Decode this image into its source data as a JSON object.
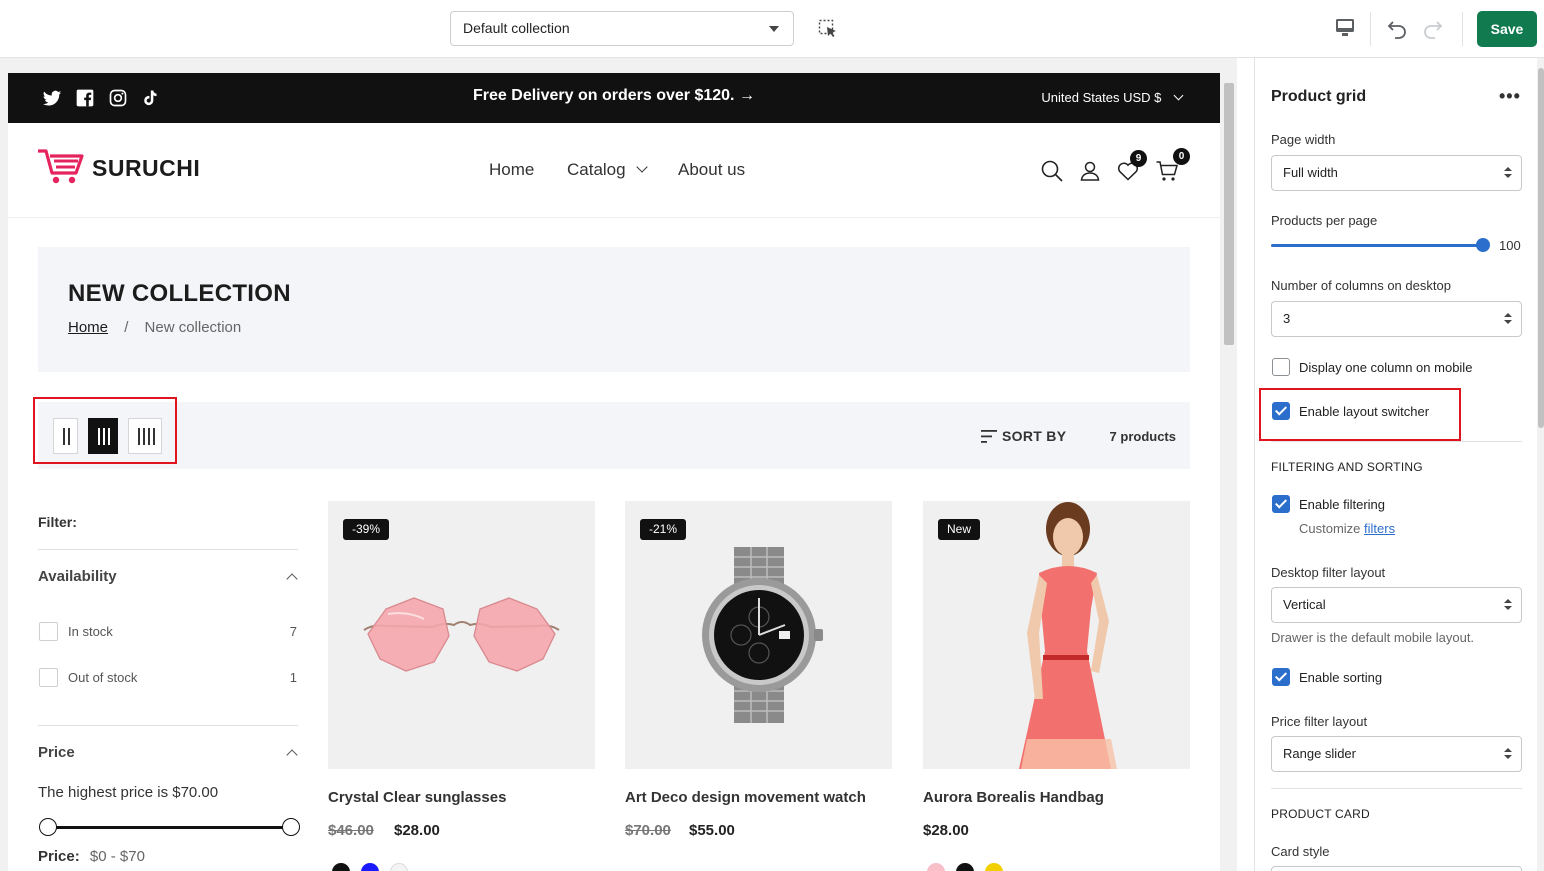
{
  "topbar": {
    "collection_select": "Default collection",
    "save_label": "Save"
  },
  "announcement": {
    "text": "Free Delivery on orders over $120.",
    "currency": "United States USD $"
  },
  "store": {
    "logo": "SURUCHI",
    "nav": [
      "Home",
      "Catalog",
      "About us"
    ],
    "wishlist_count": "9",
    "cart_count": "0"
  },
  "hero": {
    "title": "NEW COLLECTION",
    "crumb_home": "Home",
    "crumb_sep": "/",
    "crumb_current": "New collection"
  },
  "toolbar": {
    "sort_label": "SORT BY",
    "product_count": "7 products"
  },
  "filters": {
    "label": "Filter:",
    "availability": {
      "title": "Availability",
      "options": [
        {
          "label": "In stock",
          "count": "7"
        },
        {
          "label": "Out of stock",
          "count": "1"
        }
      ]
    },
    "price": {
      "title": "Price",
      "note": "The highest price is $70.00",
      "range_label": "Price:",
      "range_value": "$0 - $70"
    }
  },
  "products": [
    {
      "badge": "-39%",
      "title": "Crystal Clear sunglasses",
      "old_price": "$46.00",
      "price": "$28.00",
      "swatches": [
        "#111111",
        "#1a1aff",
        "#f4f4f4"
      ]
    },
    {
      "badge": "-21%",
      "title": "Art Deco design movement watch",
      "old_price": "$70.00",
      "price": "$55.00",
      "swatches": []
    },
    {
      "badge": "New",
      "title": "Aurora Borealis Handbag",
      "old_price": "",
      "price": "$28.00",
      "swatches": [
        "#f7c0c8",
        "#111111",
        "#f2d000"
      ]
    }
  ],
  "panel": {
    "title": "Product grid",
    "page_width_label": "Page width",
    "page_width_value": "Full width",
    "products_per_page_label": "Products per page",
    "products_per_page_value": "100",
    "columns_label": "Number of columns on desktop",
    "columns_value": "3",
    "one_column_mobile": "Display one column on mobile",
    "layout_switcher": "Enable layout switcher",
    "filtering_section": "FILTERING AND SORTING",
    "enable_filtering": "Enable filtering",
    "customize_prefix": "Customize",
    "customize_link": "filters",
    "desktop_filter_label": "Desktop filter layout",
    "desktop_filter_value": "Vertical",
    "drawer_note": "Drawer is the default mobile layout.",
    "enable_sorting": "Enable sorting",
    "price_filter_label": "Price filter layout",
    "price_filter_value": "Range slider",
    "product_card_section": "PRODUCT CARD",
    "card_style_label": "Card style"
  },
  "colors": {
    "accent": "#127a4f",
    "checkbox": "#2c6ecb",
    "highlight": "#e0141e",
    "logo_pink": "#e5245e"
  }
}
